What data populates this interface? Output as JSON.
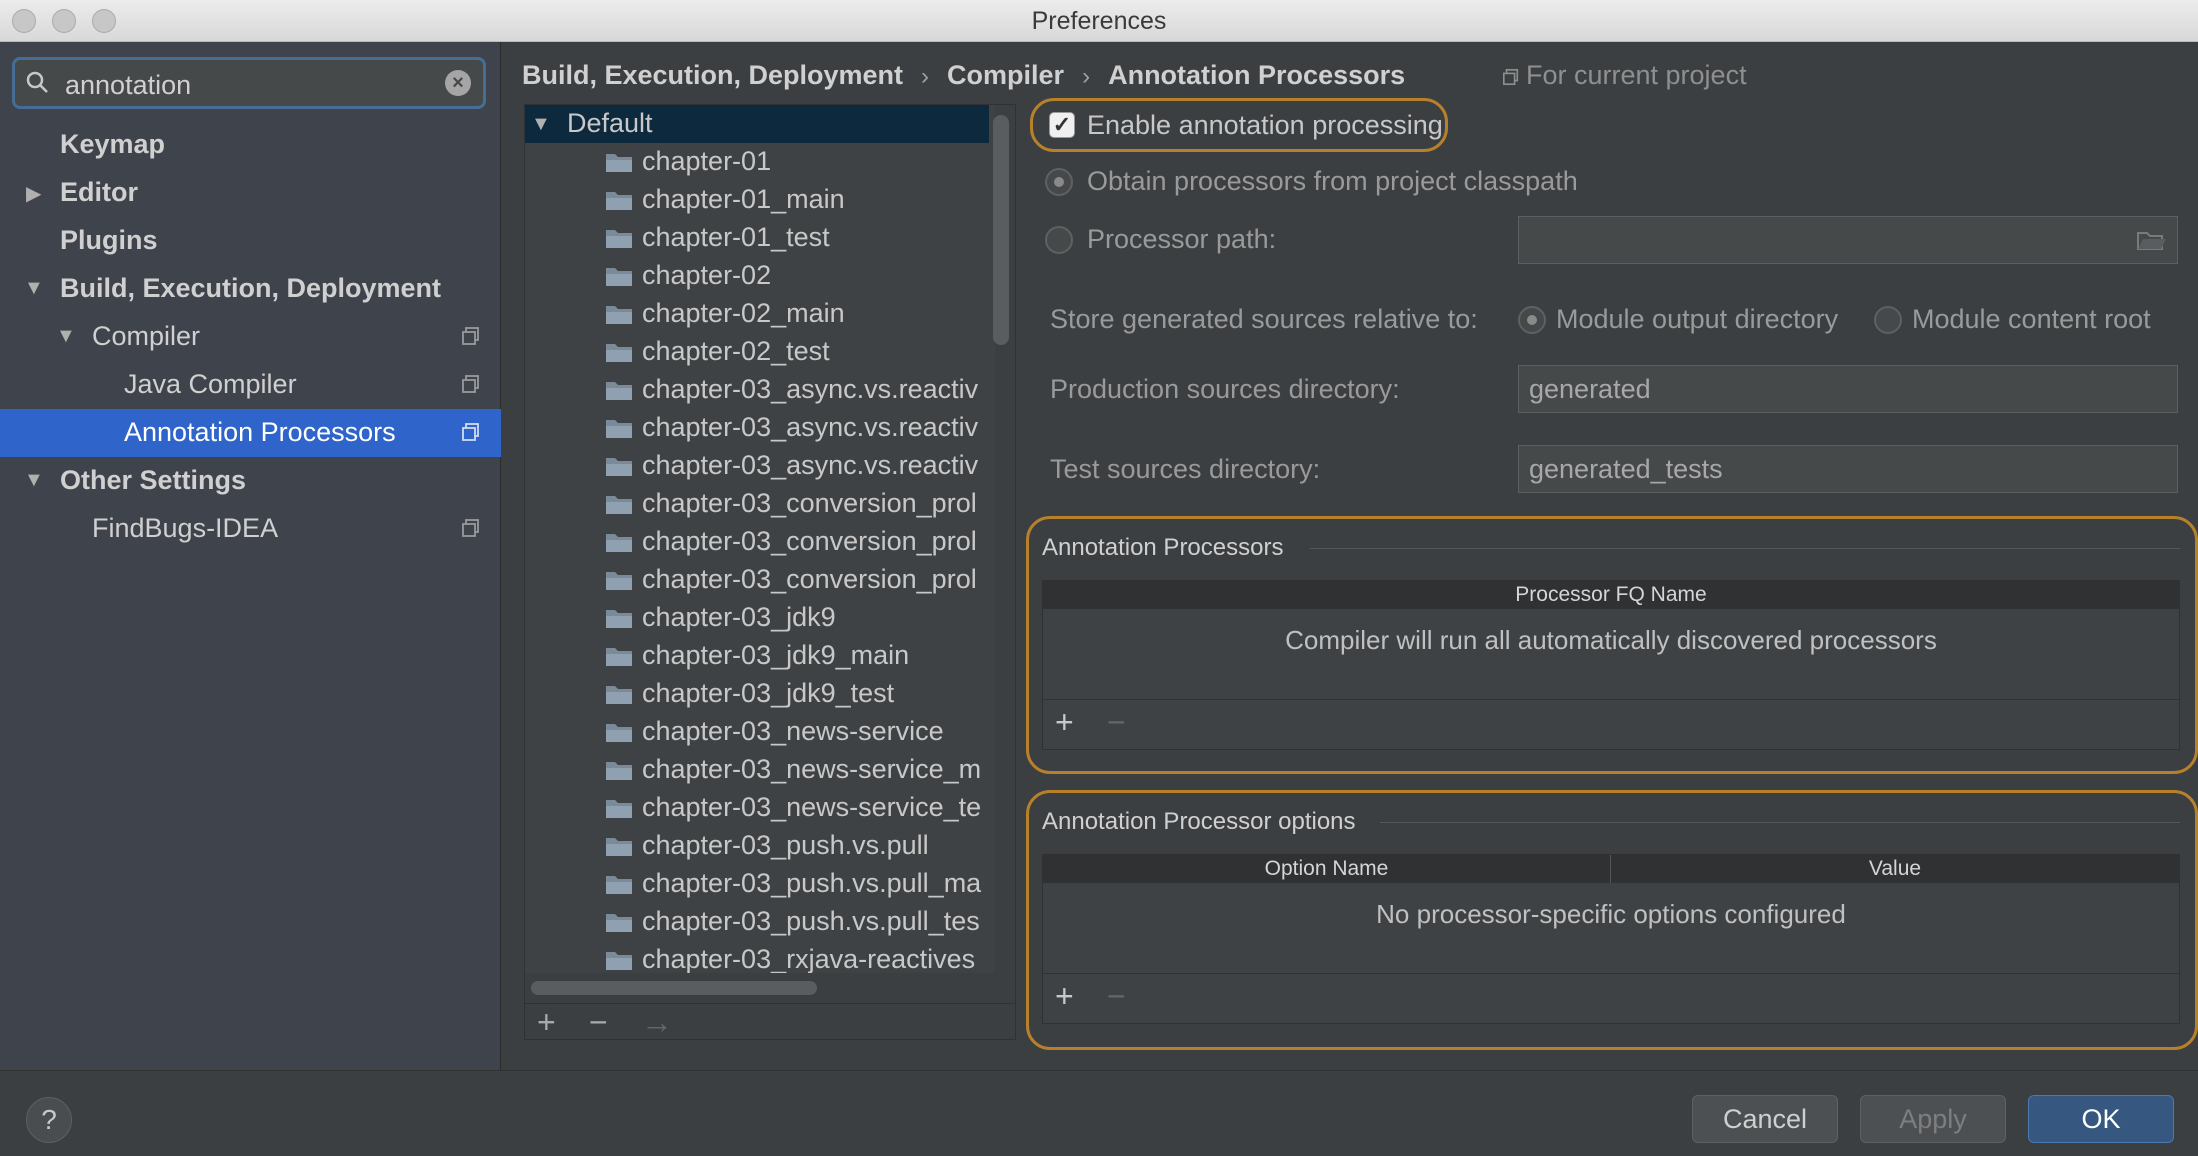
{
  "window": {
    "title": "Preferences"
  },
  "search": {
    "value": "annotation",
    "icon": "search-icon"
  },
  "sidebar": {
    "items": [
      {
        "label": "Keymap"
      },
      {
        "label": "Editor"
      },
      {
        "label": "Plugins"
      },
      {
        "label": "Build, Execution, Deployment"
      },
      {
        "label": "Compiler"
      },
      {
        "label": "Java Compiler"
      },
      {
        "label": "Annotation Processors"
      },
      {
        "label": "Other Settings"
      },
      {
        "label": "FindBugs-IDEA"
      }
    ]
  },
  "breadcrumb": {
    "parts": [
      "Build, Execution, Deployment",
      "Compiler",
      "Annotation Processors"
    ],
    "separator": "›",
    "scope": "For current project"
  },
  "tree": {
    "root": "Default",
    "items": [
      "chapter-01",
      "chapter-01_main",
      "chapter-01_test",
      "chapter-02",
      "chapter-02_main",
      "chapter-02_test",
      "chapter-03_async.vs.reactiv",
      "chapter-03_async.vs.reactiv",
      "chapter-03_async.vs.reactiv",
      "chapter-03_conversion_prol",
      "chapter-03_conversion_prol",
      "chapter-03_conversion_prol",
      "chapter-03_jdk9",
      "chapter-03_jdk9_main",
      "chapter-03_jdk9_test",
      "chapter-03_news-service",
      "chapter-03_news-service_m",
      "chapter-03_news-service_te",
      "chapter-03_push.vs.pull",
      "chapter-03_push.vs.pull_ma",
      "chapter-03_push.vs.pull_tes",
      "chapter-03_rxjava-reactives"
    ],
    "toolbar": {
      "add": "+",
      "remove": "−",
      "move": "→"
    }
  },
  "settings": {
    "enable_label": "Enable annotation processing",
    "enable_checked": true,
    "obtain_label": "Obtain processors from project classpath",
    "processor_path_label": "Processor path:",
    "processor_path_value": "",
    "store_label": "Store generated sources relative to:",
    "module_output_label": "Module output directory",
    "module_content_label": "Module content root",
    "production_label": "Production sources directory:",
    "production_value": "generated",
    "test_label": "Test sources directory:",
    "test_value": "generated_tests"
  },
  "processors_panel": {
    "title": "Annotation Processors",
    "column": "Processor FQ Name",
    "empty": "Compiler will run all automatically discovered processors",
    "add": "+",
    "remove": "−"
  },
  "options_panel": {
    "title": "Annotation Processor options",
    "columns": [
      "Option Name",
      "Value"
    ],
    "empty": "No processor-specific options configured",
    "add": "+",
    "remove": "−"
  },
  "footer": {
    "help": "?",
    "cancel": "Cancel",
    "apply": "Apply",
    "ok": "OK"
  },
  "colors": {
    "selection": "#2f65ca",
    "highlight_border": "#b7802a",
    "ok_button": "#365880"
  }
}
